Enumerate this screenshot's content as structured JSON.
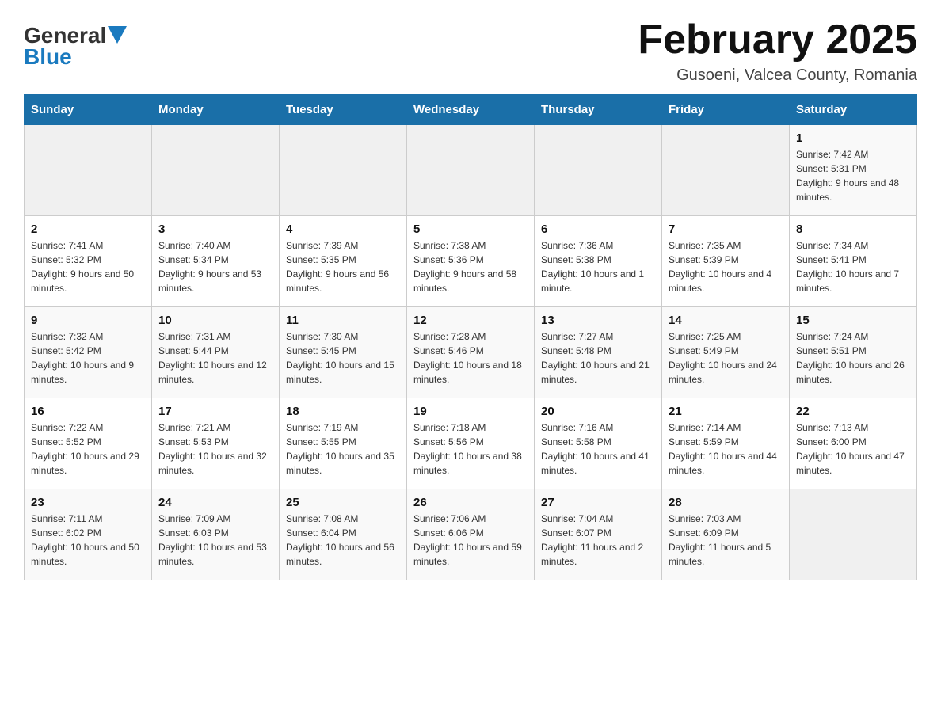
{
  "logo": {
    "text_general": "General",
    "arrow": "▶",
    "text_blue": "Blue"
  },
  "header": {
    "title": "February 2025",
    "subtitle": "Gusoeni, Valcea County, Romania"
  },
  "weekdays": [
    "Sunday",
    "Monday",
    "Tuesday",
    "Wednesday",
    "Thursday",
    "Friday",
    "Saturday"
  ],
  "weeks": [
    [
      {
        "day": "",
        "info": ""
      },
      {
        "day": "",
        "info": ""
      },
      {
        "day": "",
        "info": ""
      },
      {
        "day": "",
        "info": ""
      },
      {
        "day": "",
        "info": ""
      },
      {
        "day": "",
        "info": ""
      },
      {
        "day": "1",
        "info": "Sunrise: 7:42 AM\nSunset: 5:31 PM\nDaylight: 9 hours and 48 minutes."
      }
    ],
    [
      {
        "day": "2",
        "info": "Sunrise: 7:41 AM\nSunset: 5:32 PM\nDaylight: 9 hours and 50 minutes."
      },
      {
        "day": "3",
        "info": "Sunrise: 7:40 AM\nSunset: 5:34 PM\nDaylight: 9 hours and 53 minutes."
      },
      {
        "day": "4",
        "info": "Sunrise: 7:39 AM\nSunset: 5:35 PM\nDaylight: 9 hours and 56 minutes."
      },
      {
        "day": "5",
        "info": "Sunrise: 7:38 AM\nSunset: 5:36 PM\nDaylight: 9 hours and 58 minutes."
      },
      {
        "day": "6",
        "info": "Sunrise: 7:36 AM\nSunset: 5:38 PM\nDaylight: 10 hours and 1 minute."
      },
      {
        "day": "7",
        "info": "Sunrise: 7:35 AM\nSunset: 5:39 PM\nDaylight: 10 hours and 4 minutes."
      },
      {
        "day": "8",
        "info": "Sunrise: 7:34 AM\nSunset: 5:41 PM\nDaylight: 10 hours and 7 minutes."
      }
    ],
    [
      {
        "day": "9",
        "info": "Sunrise: 7:32 AM\nSunset: 5:42 PM\nDaylight: 10 hours and 9 minutes."
      },
      {
        "day": "10",
        "info": "Sunrise: 7:31 AM\nSunset: 5:44 PM\nDaylight: 10 hours and 12 minutes."
      },
      {
        "day": "11",
        "info": "Sunrise: 7:30 AM\nSunset: 5:45 PM\nDaylight: 10 hours and 15 minutes."
      },
      {
        "day": "12",
        "info": "Sunrise: 7:28 AM\nSunset: 5:46 PM\nDaylight: 10 hours and 18 minutes."
      },
      {
        "day": "13",
        "info": "Sunrise: 7:27 AM\nSunset: 5:48 PM\nDaylight: 10 hours and 21 minutes."
      },
      {
        "day": "14",
        "info": "Sunrise: 7:25 AM\nSunset: 5:49 PM\nDaylight: 10 hours and 24 minutes."
      },
      {
        "day": "15",
        "info": "Sunrise: 7:24 AM\nSunset: 5:51 PM\nDaylight: 10 hours and 26 minutes."
      }
    ],
    [
      {
        "day": "16",
        "info": "Sunrise: 7:22 AM\nSunset: 5:52 PM\nDaylight: 10 hours and 29 minutes."
      },
      {
        "day": "17",
        "info": "Sunrise: 7:21 AM\nSunset: 5:53 PM\nDaylight: 10 hours and 32 minutes."
      },
      {
        "day": "18",
        "info": "Sunrise: 7:19 AM\nSunset: 5:55 PM\nDaylight: 10 hours and 35 minutes."
      },
      {
        "day": "19",
        "info": "Sunrise: 7:18 AM\nSunset: 5:56 PM\nDaylight: 10 hours and 38 minutes."
      },
      {
        "day": "20",
        "info": "Sunrise: 7:16 AM\nSunset: 5:58 PM\nDaylight: 10 hours and 41 minutes."
      },
      {
        "day": "21",
        "info": "Sunrise: 7:14 AM\nSunset: 5:59 PM\nDaylight: 10 hours and 44 minutes."
      },
      {
        "day": "22",
        "info": "Sunrise: 7:13 AM\nSunset: 6:00 PM\nDaylight: 10 hours and 47 minutes."
      }
    ],
    [
      {
        "day": "23",
        "info": "Sunrise: 7:11 AM\nSunset: 6:02 PM\nDaylight: 10 hours and 50 minutes."
      },
      {
        "day": "24",
        "info": "Sunrise: 7:09 AM\nSunset: 6:03 PM\nDaylight: 10 hours and 53 minutes."
      },
      {
        "day": "25",
        "info": "Sunrise: 7:08 AM\nSunset: 6:04 PM\nDaylight: 10 hours and 56 minutes."
      },
      {
        "day": "26",
        "info": "Sunrise: 7:06 AM\nSunset: 6:06 PM\nDaylight: 10 hours and 59 minutes."
      },
      {
        "day": "27",
        "info": "Sunrise: 7:04 AM\nSunset: 6:07 PM\nDaylight: 11 hours and 2 minutes."
      },
      {
        "day": "28",
        "info": "Sunrise: 7:03 AM\nSunset: 6:09 PM\nDaylight: 11 hours and 5 minutes."
      },
      {
        "day": "",
        "info": ""
      }
    ]
  ]
}
